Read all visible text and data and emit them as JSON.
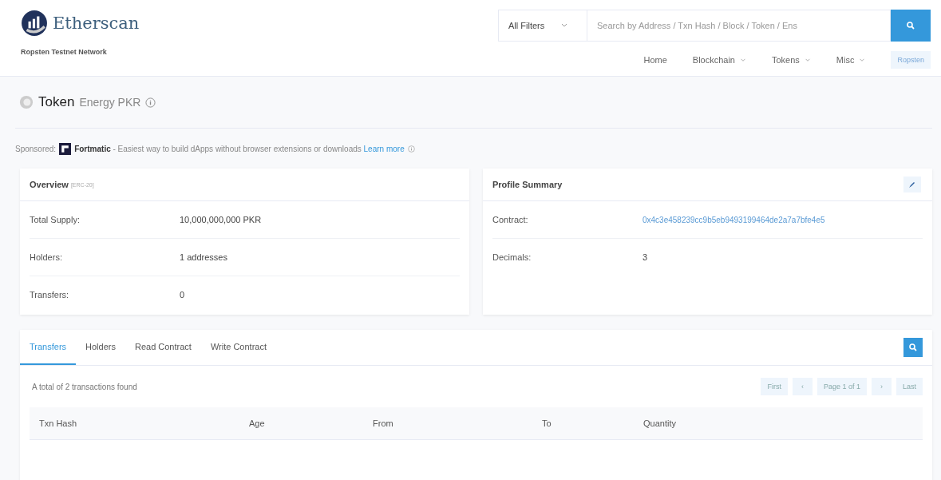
{
  "header": {
    "logo_text": "Etherscan",
    "network": "Ropsten Testnet Network",
    "filter": "All Filters",
    "search_placeholder": "Search by Address / Txn Hash / Block / Token / Ens",
    "nav": [
      {
        "label": "Home",
        "dropdown": false
      },
      {
        "label": "Blockchain",
        "dropdown": true
      },
      {
        "label": "Tokens",
        "dropdown": true
      },
      {
        "label": "Misc",
        "dropdown": true
      }
    ],
    "network_button": "Ropsten"
  },
  "page_title": {
    "title": "Token",
    "name": "Energy PKR"
  },
  "sponsored": {
    "label": "Sponsored:",
    "brand": "Fortmatic",
    "text": "- Easiest way to build dApps without browser extensions or downloads",
    "link": "Learn more"
  },
  "overview": {
    "title": "Overview",
    "badge": "[ERC-20]",
    "rows": [
      {
        "label": "Total Supply:",
        "value": "10,000,000,000 PKR",
        "kind": "text"
      },
      {
        "label": "Holders:",
        "value": "1 addresses",
        "kind": "text"
      },
      {
        "label": "Transfers:",
        "value": "0",
        "kind": "text"
      }
    ]
  },
  "profile": {
    "title": "Profile Summary",
    "rows": [
      {
        "label": "Contract:",
        "value": "0x4c3e458239cc9b5eb9493199464de2a7a7bfe4e5",
        "kind": "link"
      },
      {
        "label": "Decimals:",
        "value": "3",
        "kind": "text"
      }
    ]
  },
  "tabs": [
    {
      "label": "Transfers",
      "selected": true
    },
    {
      "label": "Holders",
      "selected": false
    },
    {
      "label": "Read Contract",
      "selected": false
    },
    {
      "label": "Write Contract",
      "selected": false
    }
  ],
  "summary": "A total of 2 transactions found",
  "pager": [
    {
      "label": "First",
      "kind": "text"
    },
    {
      "label": "‹",
      "kind": "arrow"
    },
    {
      "label": "Page 1 of 1",
      "kind": "text"
    },
    {
      "label": "›",
      "kind": "arrow"
    },
    {
      "label": "Last",
      "kind": "text"
    }
  ],
  "table": {
    "columns": [
      "Txn Hash",
      "Age",
      "From",
      "To",
      "Quantity"
    ]
  }
}
